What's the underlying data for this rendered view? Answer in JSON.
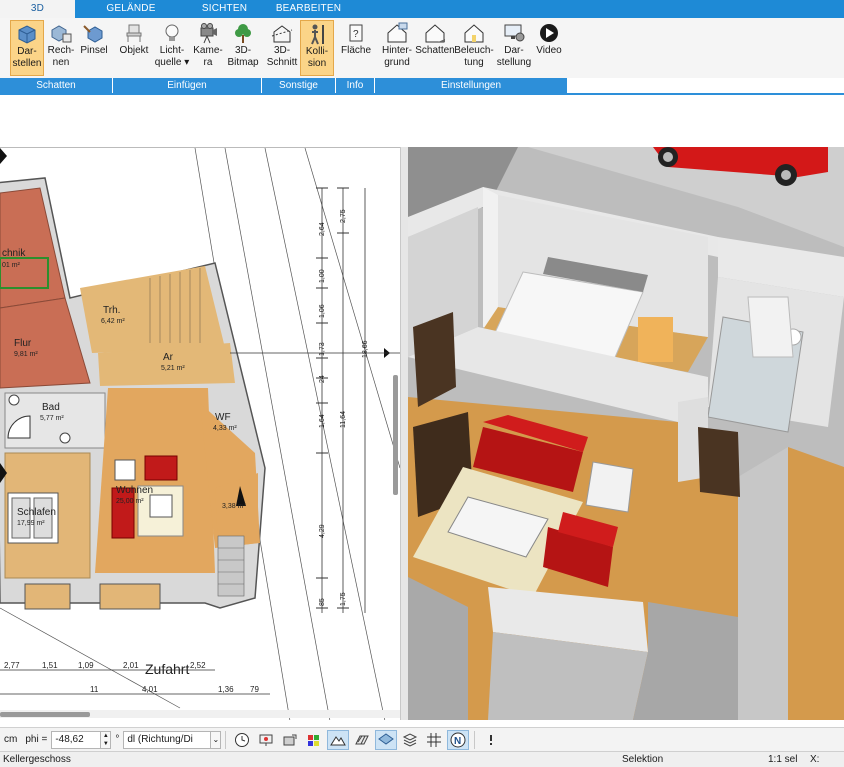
{
  "tabs": [
    "3D",
    "GELÄNDE",
    "SICHTEN",
    "BEARBEITEN"
  ],
  "ribbon": {
    "groups": [
      {
        "label": "Schatten",
        "buttons": [
          {
            "label1": "Dar-",
            "label2": "stellen",
            "icon": "cube-shade-icon",
            "active": true
          },
          {
            "label1": "Rech-",
            "label2": "nen",
            "icon": "cube-calc-icon"
          },
          {
            "label1": "Pinsel",
            "label2": "",
            "icon": "brush-cube-icon"
          }
        ]
      },
      {
        "label": "Einfügen",
        "buttons": [
          {
            "label1": "Objekt",
            "label2": "",
            "icon": "chair-icon"
          },
          {
            "label1": "Licht-",
            "label2": "quelle ▾",
            "icon": "lightbulb-icon"
          },
          {
            "label1": "Kame-",
            "label2": "ra",
            "icon": "camera-icon"
          },
          {
            "label1": "3D-",
            "label2": "Bitmap",
            "icon": "tree-icon"
          }
        ]
      },
      {
        "label": "Sonstige",
        "buttons": [
          {
            "label1": "3D-",
            "label2": "Schnitt",
            "icon": "section-icon"
          },
          {
            "label1": "Kolli-",
            "label2": "sion",
            "icon": "person-icon",
            "active": true
          }
        ]
      },
      {
        "label": "Info",
        "buttons": [
          {
            "label1": "Fläche",
            "label2": "",
            "icon": "area-info-icon"
          }
        ]
      },
      {
        "label": "Einstellungen",
        "buttons": [
          {
            "label1": "Hinter-",
            "label2": "grund",
            "icon": "house-bg-icon"
          },
          {
            "label1": "Schatten",
            "label2": "",
            "icon": "house-shadow-icon"
          },
          {
            "label1": "Beleuch-",
            "label2": "tung",
            "icon": "house-light-icon"
          },
          {
            "label1": "Dar-",
            "label2": "stellung",
            "icon": "monitor-gear-icon"
          },
          {
            "label1": "Video",
            "label2": "",
            "icon": "play-icon"
          }
        ]
      }
    ]
  },
  "plan": {
    "rooms": [
      {
        "name": "chnik",
        "area": "01 m²"
      },
      {
        "name": "Trh.",
        "area": "6,42 m²"
      },
      {
        "name": "Flur",
        "area": "9,81 m²"
      },
      {
        "name": "Ar",
        "area": "5,21 m²"
      },
      {
        "name": "Bad",
        "area": "5,77 m²"
      },
      {
        "name": "WF",
        "area": "4,33 m²"
      },
      {
        "name": "Wohnen",
        "area": "25,00 m²"
      },
      {
        "name": "Schlafen",
        "area": "17,99 m²"
      },
      {
        "name": "",
        "area": "3,38 m²"
      }
    ],
    "driveway_label": "Zufahrt",
    "dims_bottom_row1": [
      "2,77",
      "1,51",
      "1,09",
      "2,01",
      "2,52"
    ],
    "dims_bottom_row2": [
      "11",
      "4,01",
      "1,36",
      "79"
    ],
    "dims_vertical": [
      "2,64",
      "2,75",
      "1,00",
      "1,06",
      "1,73",
      "24",
      "1,64",
      "4,29",
      "85",
      "1,75",
      "18,66",
      "11,64"
    ]
  },
  "toolbar": {
    "unit": "cm",
    "phi_label": "phi =",
    "phi_value": "-48,62",
    "degree": "°",
    "dl_value": "dl (Richtung/Di"
  },
  "status": {
    "floor": "Kellergeschoss",
    "mode": "Selektion",
    "selection": "1:1 sel",
    "coord_label": "X:"
  }
}
